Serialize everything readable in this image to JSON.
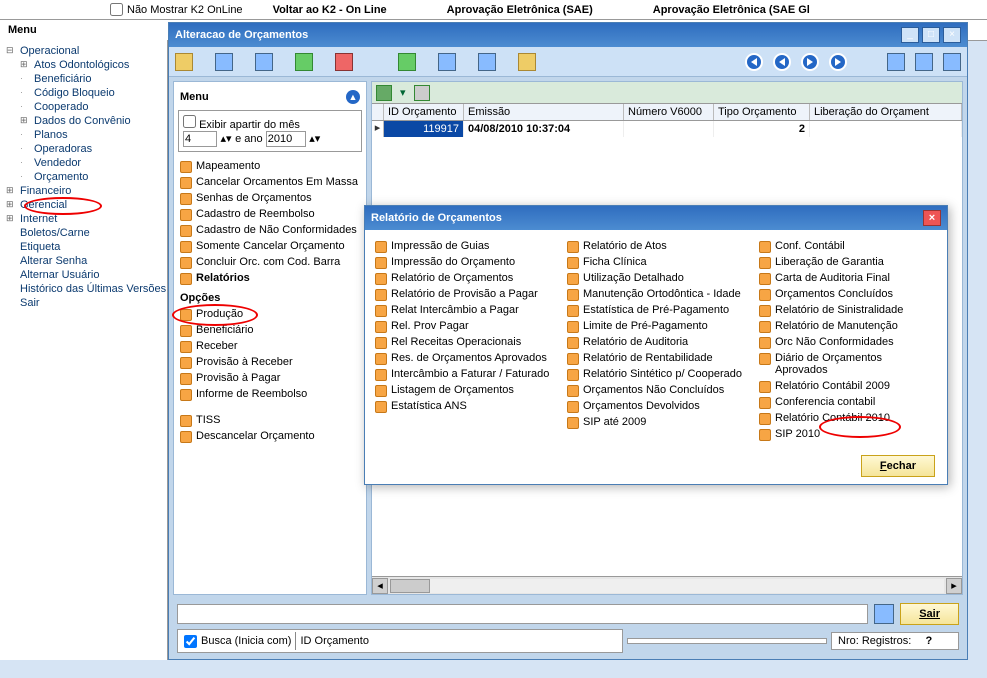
{
  "topbar": {
    "nao_mostrar": "Não Mostrar K2 OnLine",
    "voltar": "Voltar ao K2 - On Line",
    "aprov1": "Aprovação Eletrônica (SAE)",
    "aprov2": "Aprovação Eletrônica (SAE Gl"
  },
  "menu_label": "Menu",
  "tree": {
    "operacional": "Operacional",
    "atos": "Atos Odontológicos",
    "beneficiario": "Beneficiário",
    "codigo": "Código Bloqueio",
    "cooperado": "Cooperado",
    "dados": "Dados do Convênio",
    "planos": "Planos",
    "operadoras": "Operadoras",
    "vendedor": "Vendedor",
    "orcamento": "Orçamento",
    "financeiro": "Financeiro",
    "gerencial": "Gerencial",
    "internet": "Internet",
    "boletos": "Boletos/Carne",
    "etiqueta": "Etiqueta",
    "alterar_senha": "Alterar Senha",
    "alternar": "Alternar Usuário",
    "historico": "Histórico das Últimas Versões",
    "sair": "Sair"
  },
  "outer_window_title": "Alteracao de Orçamentos",
  "side_menu": {
    "title": "Menu",
    "filter_check": "Exibir apartir do mês",
    "mes": "4",
    "e_ano": "e ano",
    "ano": "2010",
    "items1": [
      "Mapeamento",
      "Cancelar Orcamentos Em Massa",
      "Senhas de Orçamentos",
      "Cadastro de Reembolso",
      "Cadastro de Não Conformidades",
      "Somente Cancelar Orçamento",
      "Concluir Orc. com Cod. Barra"
    ],
    "relatorios": "Relatórios",
    "opcoes": "Opções",
    "items2": [
      "Produção",
      "Beneficiário",
      "Receber",
      "Provisão à Receber",
      "Provisão à Pagar",
      "Informe de Reembolso"
    ],
    "items3": [
      "TISS",
      "Descancelar Orçamento"
    ]
  },
  "grid": {
    "headers": [
      "ID Orçamento",
      "Emissão",
      "Número V6000",
      "Tipo Orçamento",
      "Liberação do Orçament"
    ],
    "row": {
      "id": "119917",
      "emissao": "04/08/2010 10:37:04",
      "num": "",
      "tipo": "2",
      "lib": ""
    }
  },
  "bottom": {
    "sair": "Sair",
    "busca": "Busca (Inicia com)",
    "campo": "ID Orçamento",
    "nro": "Nro: Registros:",
    "q": "?"
  },
  "dialog": {
    "title": "Relatório de Orçamentos",
    "col1": [
      "Impressão de Guias",
      "Impressão do Orçamento",
      "Relatório de Orçamentos",
      "Relatório de Provisão a Pagar",
      "Relat Intercâmbio a Pagar",
      "Rel. Prov Pagar",
      "Rel Receitas Operacionais",
      "Res. de Orçamentos Aprovados",
      "Intercâmbio a Faturar / Faturado",
      "Listagem de Orçamentos",
      "Estatística ANS"
    ],
    "col2": [
      "Relatório de Atos",
      "Ficha Clínica",
      "Utilização Detalhado",
      "Manutenção Ortodôntica - Idade",
      "Estatística de Pré-Pagamento",
      "Limite de Pré-Pagamento",
      "Relatório de Auditoria",
      "Relatório de Rentabilidade",
      "Relatório Sintético p/ Cooperado",
      "Orçamentos Não Concluídos",
      "Orçamentos Devolvidos",
      "SIP até 2009"
    ],
    "col3": [
      "Conf. Contábil",
      "Liberação de Garantia",
      "Carta de Auditoria Final",
      "Orçamentos Concluídos",
      "Relatório de Sinistralidade",
      "Relatório de Manutenção",
      "Orc Não Conformidades",
      "Diário de Orçamentos Aprovados",
      "Relatório Contábil 2009",
      "Conferencia contabil",
      "Relatório Contábil 2010",
      "SIP 2010"
    ],
    "fechar": "Fechar"
  }
}
